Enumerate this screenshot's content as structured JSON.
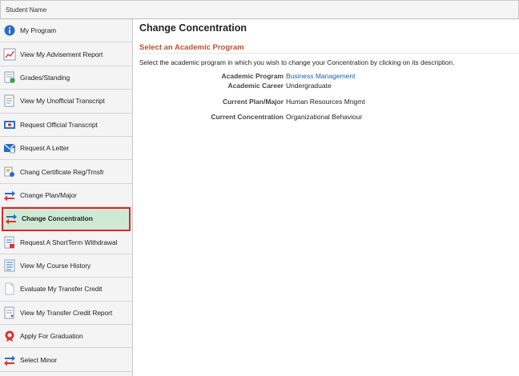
{
  "header": {
    "student_label": "Student Name"
  },
  "sidebar": {
    "items": [
      {
        "label": "My Program",
        "icon": "info-icon"
      },
      {
        "label": "View My Advisement Report",
        "icon": "chart-icon"
      },
      {
        "label": "Grades/Standing",
        "icon": "grades-icon"
      },
      {
        "label": "View My Unofficial Transcript",
        "icon": "document-icon"
      },
      {
        "label": "Request Official Transcript",
        "icon": "transcript-icon"
      },
      {
        "label": "Request A Letter",
        "icon": "letter-icon"
      },
      {
        "label": "Chang Certificate Reg/Trnsfr",
        "icon": "certificate-icon"
      },
      {
        "label": "Change Plan/Major",
        "icon": "swap-icon"
      },
      {
        "label": "Change Concentration",
        "icon": "swap-icon",
        "active": true
      },
      {
        "label": "Request A ShortTerm Withdrawal",
        "icon": "withdrawal-icon"
      },
      {
        "label": "View My Course History",
        "icon": "history-icon"
      },
      {
        "label": "Evaluate My Transfer Credit",
        "icon": "blank-document-icon"
      },
      {
        "label": "View My Transfer Credit Report",
        "icon": "report-icon"
      },
      {
        "label": "Apply For Graduation",
        "icon": "graduation-icon"
      },
      {
        "label": "Select Minor",
        "icon": "swap-icon"
      }
    ]
  },
  "main": {
    "title": "Change Concentration",
    "section_title": "Select an Academic Program",
    "instructions": "Select the academic program in which you wish to change your Concentration by clicking on its description.",
    "fields": {
      "academic_program": {
        "label": "Academic Program",
        "value": "Business Management"
      },
      "academic_career": {
        "label": "Academic Career",
        "value": "Undergraduate"
      },
      "current_plan": {
        "label": "Current Plan/Major",
        "value": "Human Resources Mngmt"
      },
      "current_concentration": {
        "label": "Current Concentration",
        "value": "Organizational Behaviour"
      }
    }
  },
  "colors": {
    "accent_orange": "#c0522a",
    "link_blue": "#1a5fb4",
    "active_bg": "#cfead4",
    "active_border": "#e0242b"
  }
}
